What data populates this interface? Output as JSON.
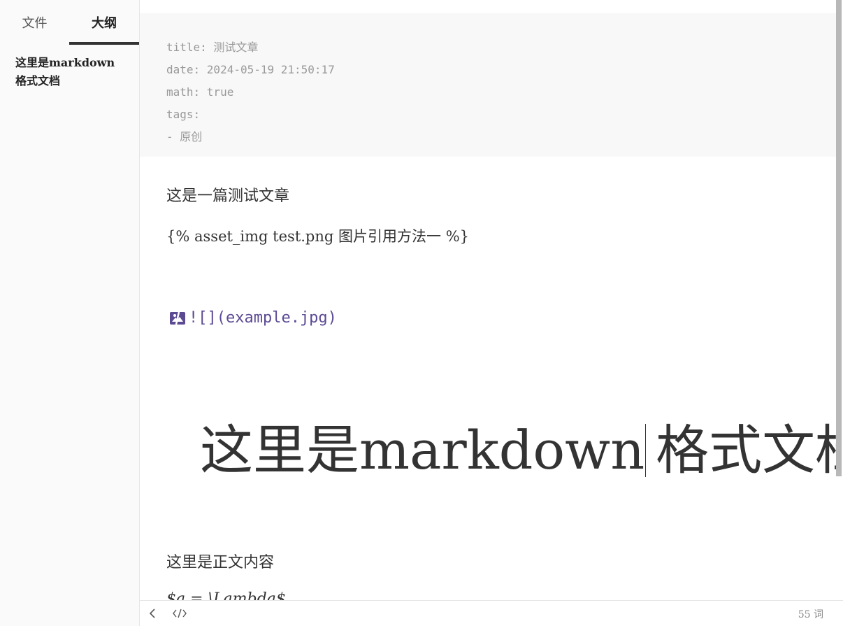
{
  "sidebar": {
    "tabs": [
      {
        "label": "文件"
      },
      {
        "label": "大纲"
      }
    ],
    "outline": [
      {
        "label": "这里是markdown 格式文档"
      }
    ]
  },
  "front_matter": {
    "lines": [
      "title: 测试文章",
      "date: 2024-05-19 21:50:17",
      "math: true",
      "tags:",
      "- 原创"
    ]
  },
  "body": {
    "paragraph_1": "这是一篇测试文章",
    "paragraph_2": "{% asset_img test.png 图片引用方法一 %}",
    "image_markdown": "![](example.jpg)",
    "heading_part1": "这里是markdown",
    "heading_part2": "格式文档",
    "paragraph_3": "这里是正文内容",
    "paragraph_4": "$a = \\Lambda$"
  },
  "footer": {
    "word_count": "55",
    "word_unit": "词"
  },
  "icons": {
    "back": "chevron-left-icon",
    "source": "code-icon",
    "broken_image": "broken-image-icon"
  },
  "colors": {
    "link_purple": "#5c4a93",
    "front_matter_bg": "#f8f8f8",
    "sidebar_bg": "#fafafa"
  }
}
